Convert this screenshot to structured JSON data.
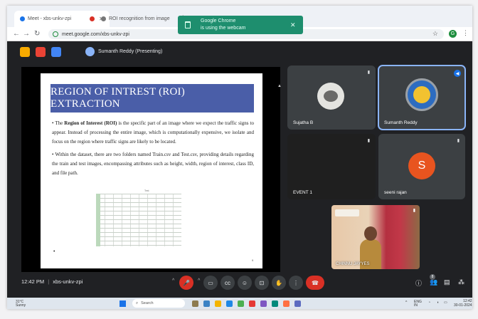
{
  "browser": {
    "tabs": [
      {
        "label": "Meet - xbs-unkv-zpi"
      },
      {
        "label": "ROI recognition from image"
      }
    ],
    "new_tab_symbol": "+",
    "url": "meet.google.com/xbs-unkv-zpi",
    "notification": {
      "line1": "Google Chrome",
      "line2": "is using the webcam",
      "close": "✕"
    },
    "profile_initial": "G"
  },
  "meet": {
    "presenter_label": "Sumanth Reddy (Presenting)",
    "slide": {
      "title": "REGION OF INTREST (ROI) EXTRACTION",
      "bullet1_prefix": "The ",
      "bullet1_bold": "Region of Interest (ROI)",
      "bullet1_rest": " is the specific part of an image where we expect the traffic signs to appear. Instead of processing the entire image, which is computationally expensive, we isolate and focus on the region where traffic signs are likely to be located.",
      "bullet2": "Within the dataset, there are two folders named Train.csv and Test.csv, providing details regarding the train and test images, encompassing attributes such as height, width, region of interest, class ID, and file path.",
      "table_caption": "Test",
      "bullet_marker": "•",
      "page": "9"
    },
    "participants": [
      {
        "name": "Sujatha B"
      },
      {
        "name": "Sumanth Reddy"
      },
      {
        "name": "EVENT 1"
      },
      {
        "name": "seeni rajan",
        "initial": "S"
      }
    ],
    "self_tile_name": "CHINNU JAYYES",
    "meeting_time": "12:42 PM",
    "meeting_code": "xbs-unkv-zpi",
    "people_count": "8"
  },
  "taskbar": {
    "weather_temp": "31°C",
    "weather_desc": "Sunny",
    "search_placeholder": "Search",
    "language": "ENG",
    "region": "IN",
    "time": "12:42",
    "date": "30-01-2024"
  },
  "colors": {
    "slide_title_bg": "#4a5ea8",
    "meet_bg": "#202124",
    "end_call": "#d93025",
    "notification": "#1e8e6e",
    "avatar_s": "#e8541f"
  }
}
